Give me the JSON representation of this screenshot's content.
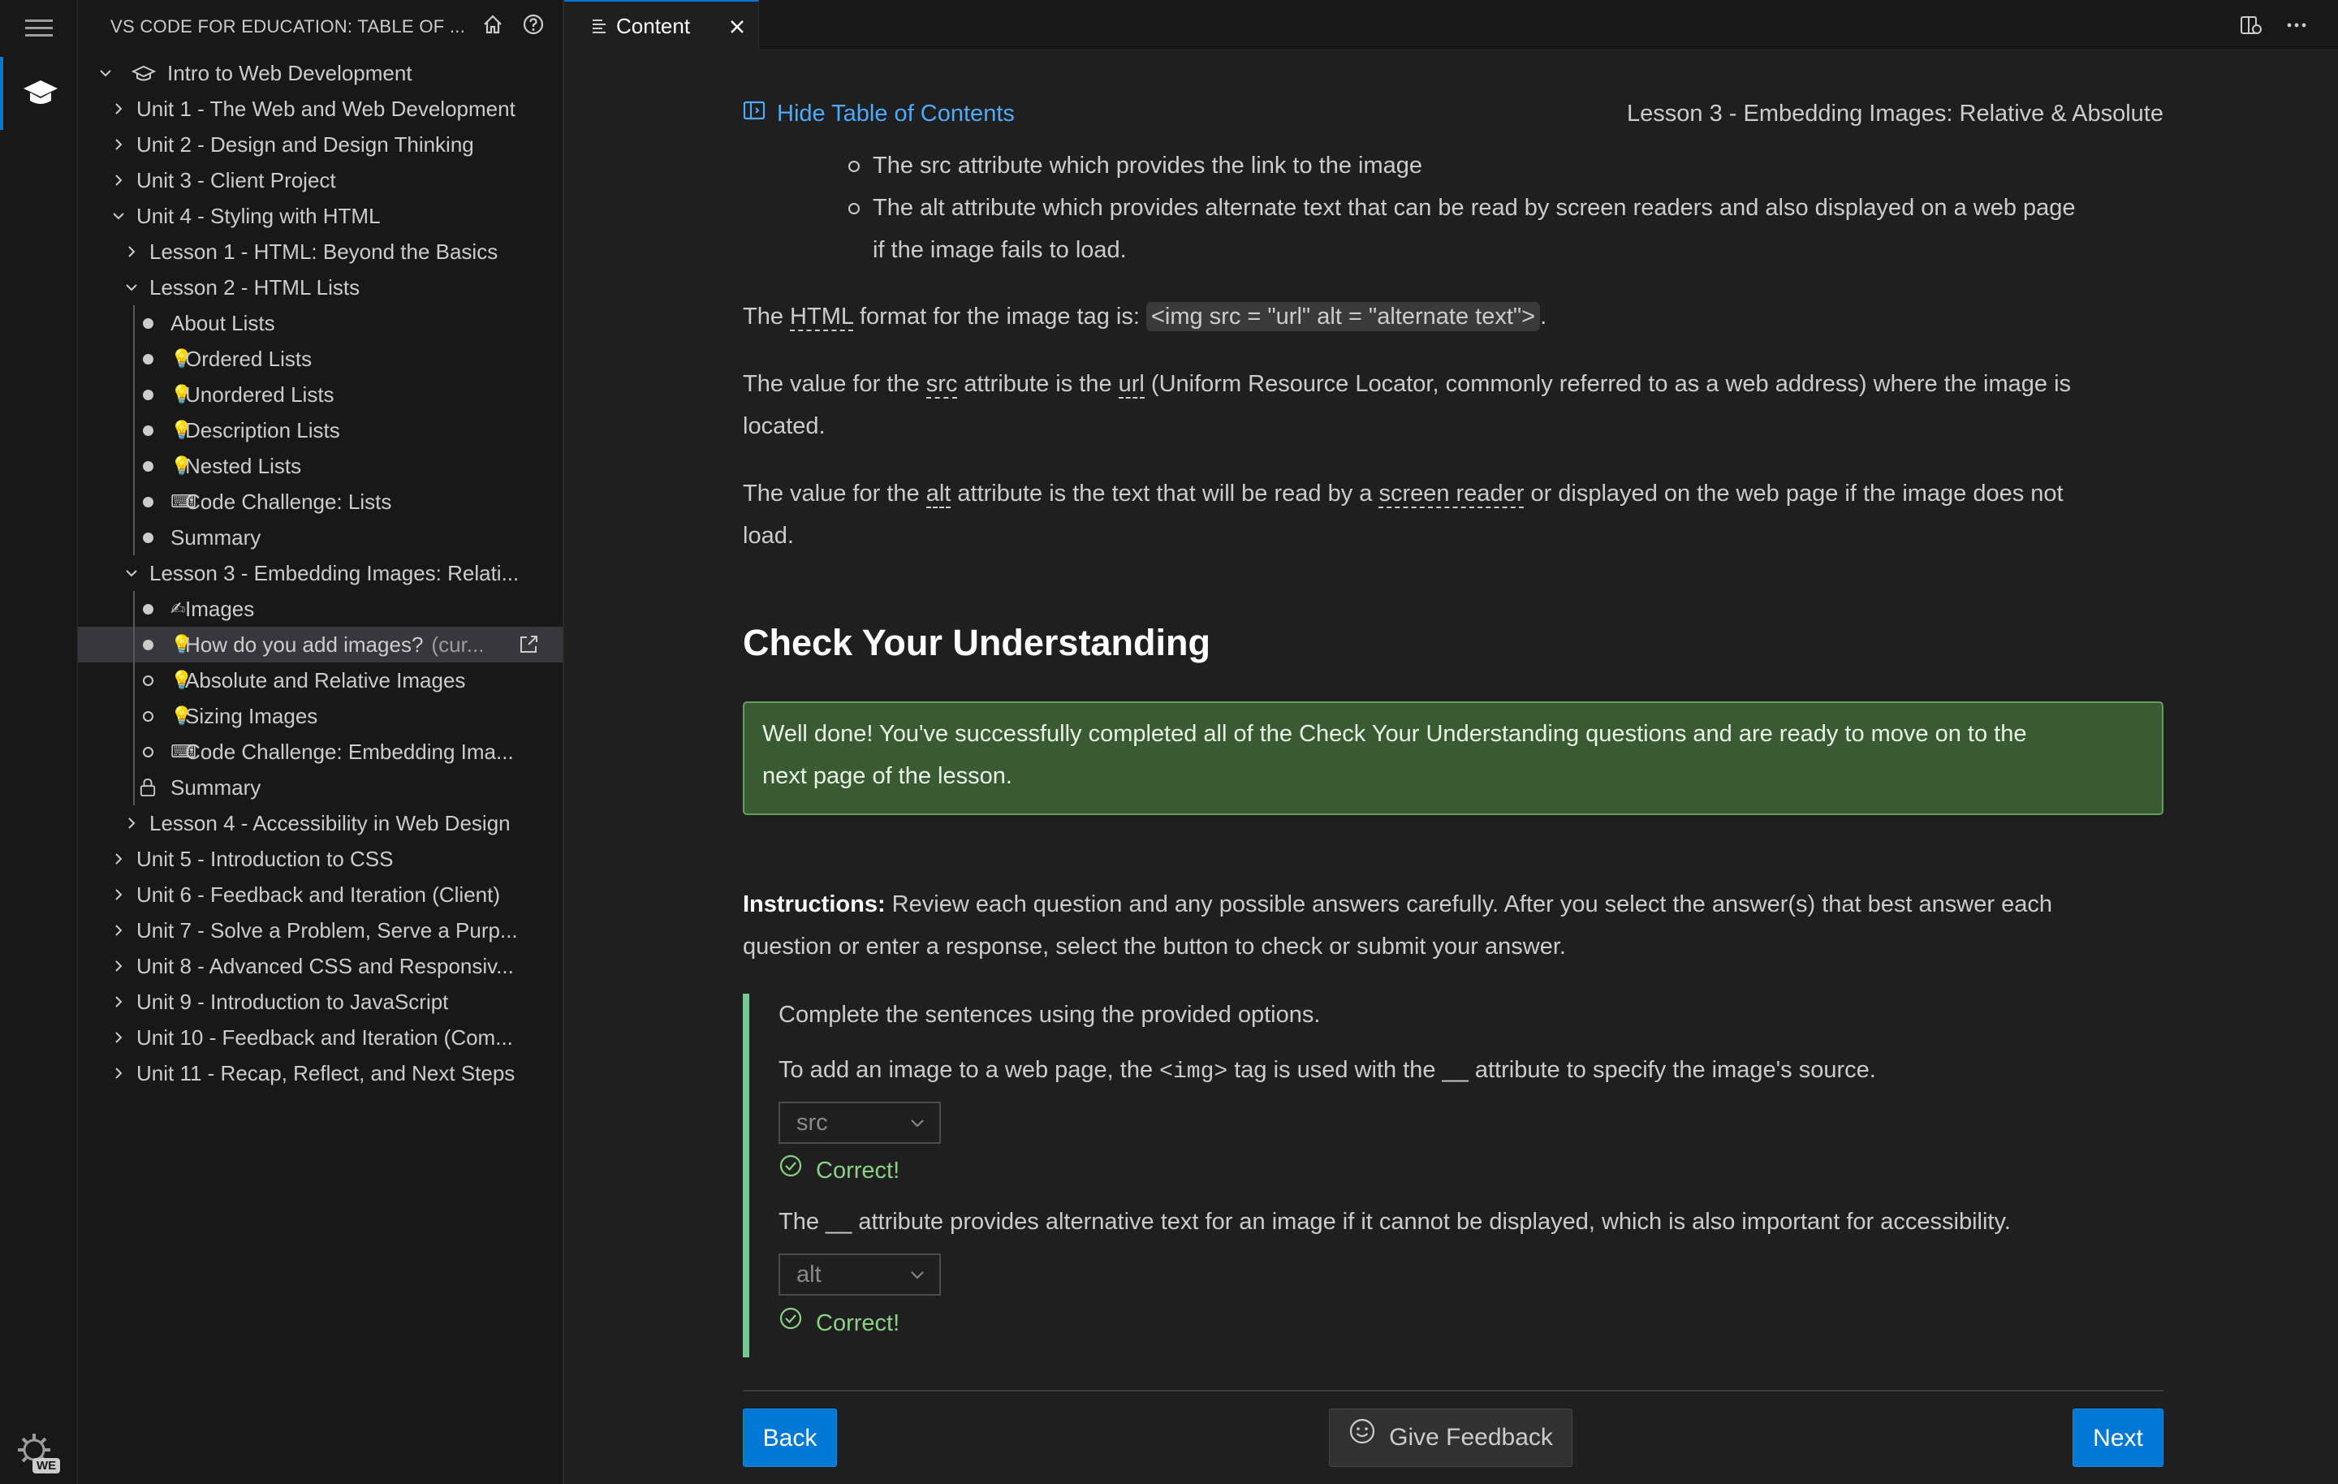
{
  "activity_bar": {
    "menu_icon": "hamburger-menu-icon",
    "education_icon": "graduation-cap-icon",
    "manage_icon": "gear-icon",
    "manage_badge": "WE"
  },
  "sidebar": {
    "title": "VS CODE FOR EDUCATION: TABLE OF ...",
    "actions": [
      "home-icon",
      "help-icon"
    ],
    "tree": [
      {
        "label": "Intro to Web Development",
        "kind": "course",
        "expanded": true
      },
      {
        "label": "Unit 1 - The Web and Web Development",
        "kind": "unit",
        "expanded": false
      },
      {
        "label": "Unit 2 - Design and Design Thinking",
        "kind": "unit",
        "expanded": false
      },
      {
        "label": "Unit 3 - Client Project",
        "kind": "unit",
        "expanded": false
      },
      {
        "label": "Unit 4 - Styling with HTML",
        "kind": "unit",
        "expanded": true
      },
      {
        "label": "Lesson 1 - HTML: Beyond the Basics",
        "kind": "lesson",
        "expanded": false
      },
      {
        "label": "Lesson 2 - HTML Lists",
        "kind": "lesson",
        "expanded": true
      },
      {
        "label": "About Lists",
        "kind": "page",
        "status": "complete",
        "emoji": ""
      },
      {
        "label": "Ordered Lists",
        "kind": "page",
        "status": "complete",
        "emoji": "💡"
      },
      {
        "label": "Unordered Lists",
        "kind": "page",
        "status": "complete",
        "emoji": "💡"
      },
      {
        "label": "Description Lists",
        "kind": "page",
        "status": "complete",
        "emoji": "💡"
      },
      {
        "label": "Nested Lists",
        "kind": "page",
        "status": "complete",
        "emoji": "💡"
      },
      {
        "label": "Code Challenge: Lists",
        "kind": "page",
        "status": "complete",
        "emoji": "⌨"
      },
      {
        "label": "Summary",
        "kind": "page",
        "status": "complete",
        "emoji": ""
      },
      {
        "label": "Lesson 3 - Embedding Images: Relati...",
        "kind": "lesson",
        "expanded": true
      },
      {
        "label": "Images",
        "kind": "page",
        "status": "complete",
        "emoji": "✍"
      },
      {
        "label": "How do you add images?",
        "description": "(cur...",
        "kind": "page",
        "status": "complete",
        "emoji": "💡",
        "active": true
      },
      {
        "label": "Absolute and Relative Images",
        "kind": "page",
        "status": "incomplete",
        "emoji": "💡"
      },
      {
        "label": "Sizing Images",
        "kind": "page",
        "status": "incomplete",
        "emoji": "💡"
      },
      {
        "label": "Code Challenge: Embedding Ima...",
        "kind": "page",
        "status": "incomplete",
        "emoji": "⌨"
      },
      {
        "label": "Summary",
        "kind": "page",
        "status": "locked",
        "emoji": ""
      },
      {
        "label": "Lesson 4 - Accessibility in Web Design",
        "kind": "lesson",
        "expanded": false
      },
      {
        "label": "Unit 5 - Introduction to CSS",
        "kind": "unit",
        "expanded": false
      },
      {
        "label": "Unit 6 - Feedback and Iteration (Client)",
        "kind": "unit",
        "expanded": false
      },
      {
        "label": "Unit 7 - Solve a Problem, Serve a Purp...",
        "kind": "unit",
        "expanded": false
      },
      {
        "label": "Unit 8 - Advanced CSS and Responsiv...",
        "kind": "unit",
        "expanded": false
      },
      {
        "label": "Unit 9 - Introduction to JavaScript",
        "kind": "unit",
        "expanded": false
      },
      {
        "label": "Unit 10 - Feedback and Iteration (Com...",
        "kind": "unit",
        "expanded": false
      },
      {
        "label": "Unit 11 - Recap, Reflect, and Next Steps",
        "kind": "unit",
        "expanded": false
      }
    ]
  },
  "tabs": [
    {
      "label": "Content",
      "icon": "list-icon",
      "close_icon": "close-icon"
    }
  ],
  "toolbar": {
    "actions": [
      "open-preview-icon",
      "more-actions-icon"
    ]
  },
  "content": {
    "toc_link": "Hide Table of Contents",
    "lesson_title": "Lesson 3 - Embedding Images: Relative & Absolute",
    "bullets": [
      "The src attribute which provides the link to the image",
      "The alt attribute which provides alternate text that can be read by screen readers and also displayed on a web page",
      "if the image fails to load."
    ],
    "p_format": {
      "pre": "The ",
      "term": "HTML",
      "mid": " format for the image tag is: ",
      "code": "<img src = \"url\" alt = \"alternate text\">",
      "post": "."
    },
    "p_src": {
      "pre": "The value for the ",
      "term1": "src",
      "mid": " attribute is the ",
      "term2": "url",
      "post": " (Uniform Resource Locator, commonly referred to as a web address) where the image is",
      "line2": "located."
    },
    "p_alt": {
      "pre": "The value for the ",
      "term1": "alt",
      "mid": " attribute is the text that will be read by a ",
      "term2": "screen reader",
      "post": " or displayed on the web page if the image does not",
      "line2": "load."
    },
    "check_heading": "Check Your Understanding",
    "success_message_line1": "Well done! You've successfully completed all of the Check Your Understanding questions and are ready to move on to the",
    "success_message_line2": "next page of the lesson.",
    "instructions_label": "Instructions:",
    "instructions_line1": " Review each question and any possible answers carefully. After you select the answer(s) that best answer each",
    "instructions_line2": "question or enter a response, select the button to check or submit your answer.",
    "question_block": {
      "prompt": "Complete the sentences using the provided options.",
      "q1": {
        "pre": "To add an image to a web page, the ",
        "code": "<img>",
        "post": " tag is used with the __ attribute to specify the image's source."
      },
      "q1_answer": "src",
      "q1_result": "Correct!",
      "q2": "The __ attribute provides alternative text for an image if it cannot be displayed, which is also important for accessibility.",
      "q2_answer": "alt",
      "q2_result": "Correct!"
    },
    "buttons": {
      "back": "Back",
      "feedback": "Give Feedback",
      "next": "Next"
    }
  },
  "colors": {
    "accent": "#0078d4",
    "link": "#4daafc",
    "success_bg": "#3a5a34",
    "success_border": "#63a05a",
    "correct": "#89d185",
    "quote_bar": "#73c991"
  }
}
